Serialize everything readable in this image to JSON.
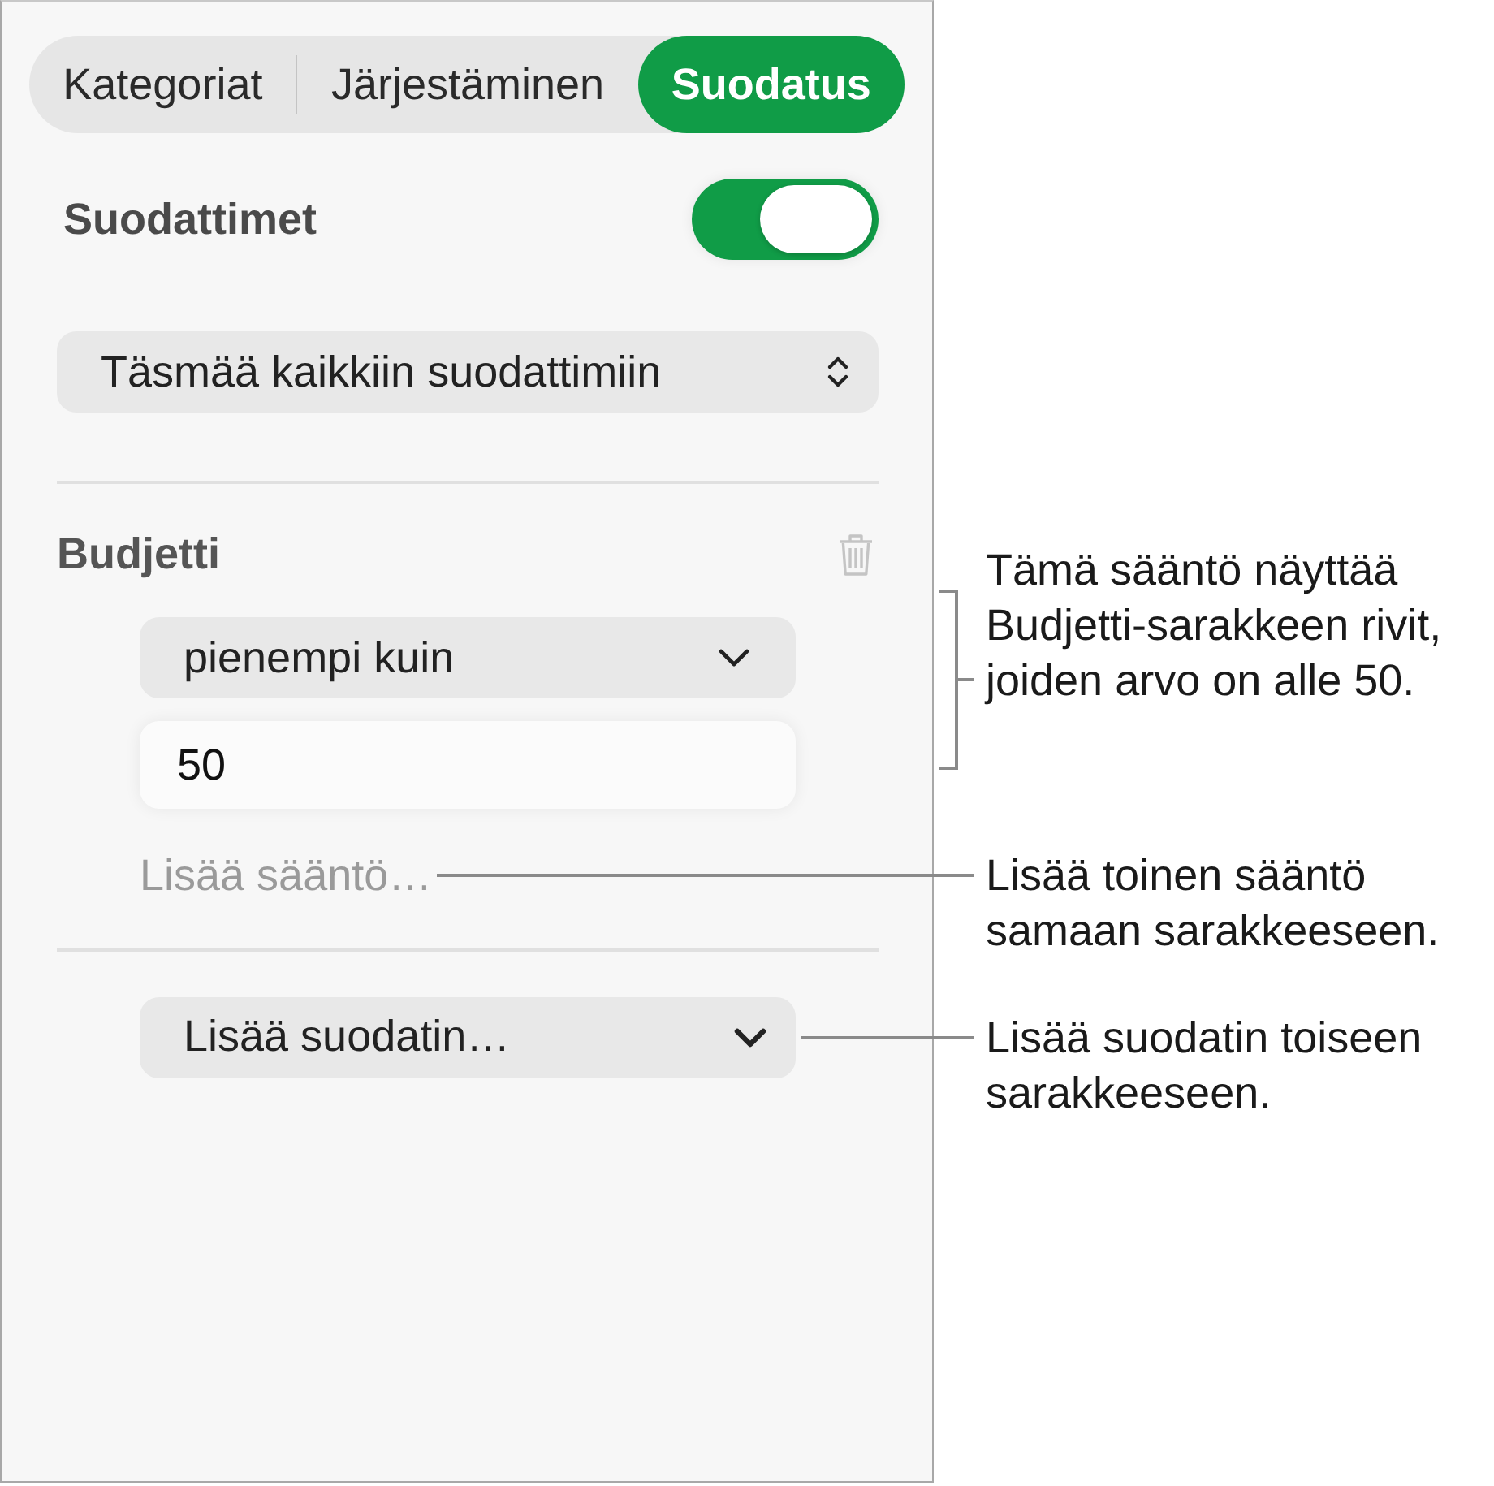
{
  "panel": {
    "tabs": [
      {
        "label": "Kategoriat",
        "selected": false
      },
      {
        "label": "Järjestäminen",
        "selected": false
      },
      {
        "label": "Suodatus",
        "selected": true
      }
    ],
    "filters_toggle": {
      "label": "Suodattimet",
      "on": true
    },
    "match_select": {
      "value": "Täsmää kaikkiin suodattimiin"
    },
    "filter": {
      "column": "Budjetti",
      "rule_select": {
        "value": "pienempi kuin"
      },
      "rule_value": "50",
      "add_rule": "Lisää sääntö…"
    },
    "add_filter": {
      "value": "Lisää suodatin…"
    }
  },
  "callouts": [
    {
      "kind": "bracket",
      "lines": [
        "Tämä sääntö näyttää",
        "Budjetti-sarakkeen rivit,",
        "joiden arvo on alle 50."
      ]
    },
    {
      "kind": "leader",
      "lines": [
        "Lisää toinen sääntö",
        "samaan sarakkeeseen."
      ]
    },
    {
      "kind": "leader",
      "lines": [
        "Lisää suodatin toiseen",
        "sarakkeeseen."
      ]
    }
  ]
}
